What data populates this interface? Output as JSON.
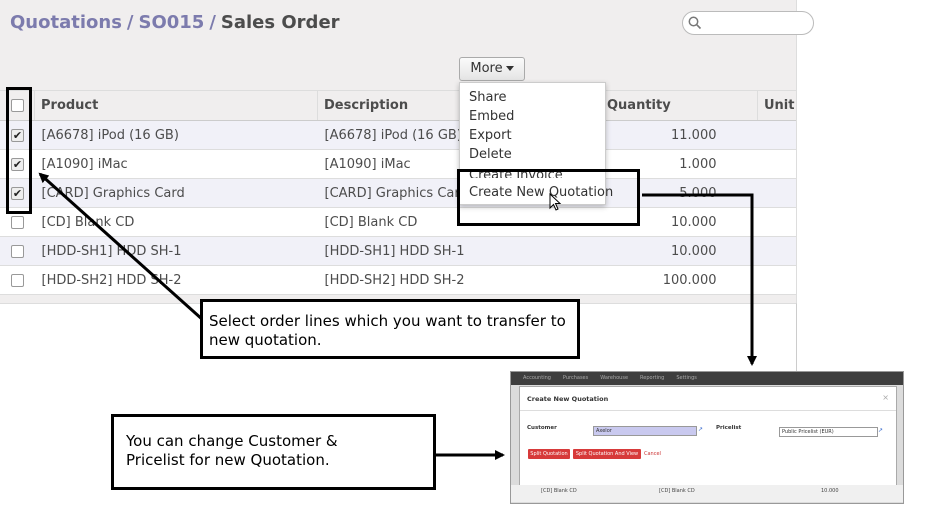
{
  "breadcrumb": {
    "level1": "Quotations",
    "level2": "SO015",
    "current": "Sales Order"
  },
  "search": {
    "icon": "search-icon"
  },
  "toolbar": {
    "more_label": "More"
  },
  "table": {
    "columns": [
      "Product",
      "Description",
      "Quantity",
      "Unit"
    ],
    "rows": [
      {
        "checked": true,
        "product": "[A6678] iPod (16 GB)",
        "description": "[A6678] iPod (16 GB)",
        "quantity": "11.000"
      },
      {
        "checked": true,
        "product": "[A1090] iMac",
        "description": "[A1090] iMac",
        "quantity": "1.000"
      },
      {
        "checked": true,
        "product": "[CARD] Graphics Card",
        "description": "[CARD] Graphics Card",
        "quantity": "5.000"
      },
      {
        "checked": false,
        "product": "[CD] Blank CD",
        "description": "[CD] Blank CD",
        "quantity": "10.000"
      },
      {
        "checked": false,
        "product": "[HDD-SH1] HDD SH-1",
        "description": "[HDD-SH1] HDD SH-1",
        "quantity": "10.000"
      },
      {
        "checked": false,
        "product": "[HDD-SH2] HDD SH-2",
        "description": "[HDD-SH2] HDD SH-2",
        "quantity": "100.000"
      }
    ]
  },
  "more_menu": {
    "items": [
      "Share",
      "Embed",
      "Export",
      "Delete",
      "Create Invoice",
      "Create New Quotation"
    ]
  },
  "callouts": {
    "select_lines": "Select order lines which you want to transfer to new quotation.",
    "change_customer": "You can change Customer & Pricelist for new Quotation."
  },
  "inset": {
    "menu": [
      "Accounting",
      "Purchases",
      "Warehouse",
      "Reporting",
      "Settings"
    ],
    "modal_title": "Create New Quotation",
    "customer_label": "Customer",
    "customer_value": "Axelor",
    "pricelist_label": "Pricelist",
    "pricelist_value": "Public Pricelist (EUR)",
    "split_button": "Split Quotation",
    "split_view_button": "Split Quotation And View",
    "cancel_label": "Cancel",
    "bg_row": {
      "product": "[CD] Blank CD",
      "description": "[CD] Blank CD",
      "quantity": "10.000"
    }
  },
  "colors": {
    "accent": "#7c7bad",
    "button_red": "#d73a3a",
    "annotation": "#000000"
  }
}
